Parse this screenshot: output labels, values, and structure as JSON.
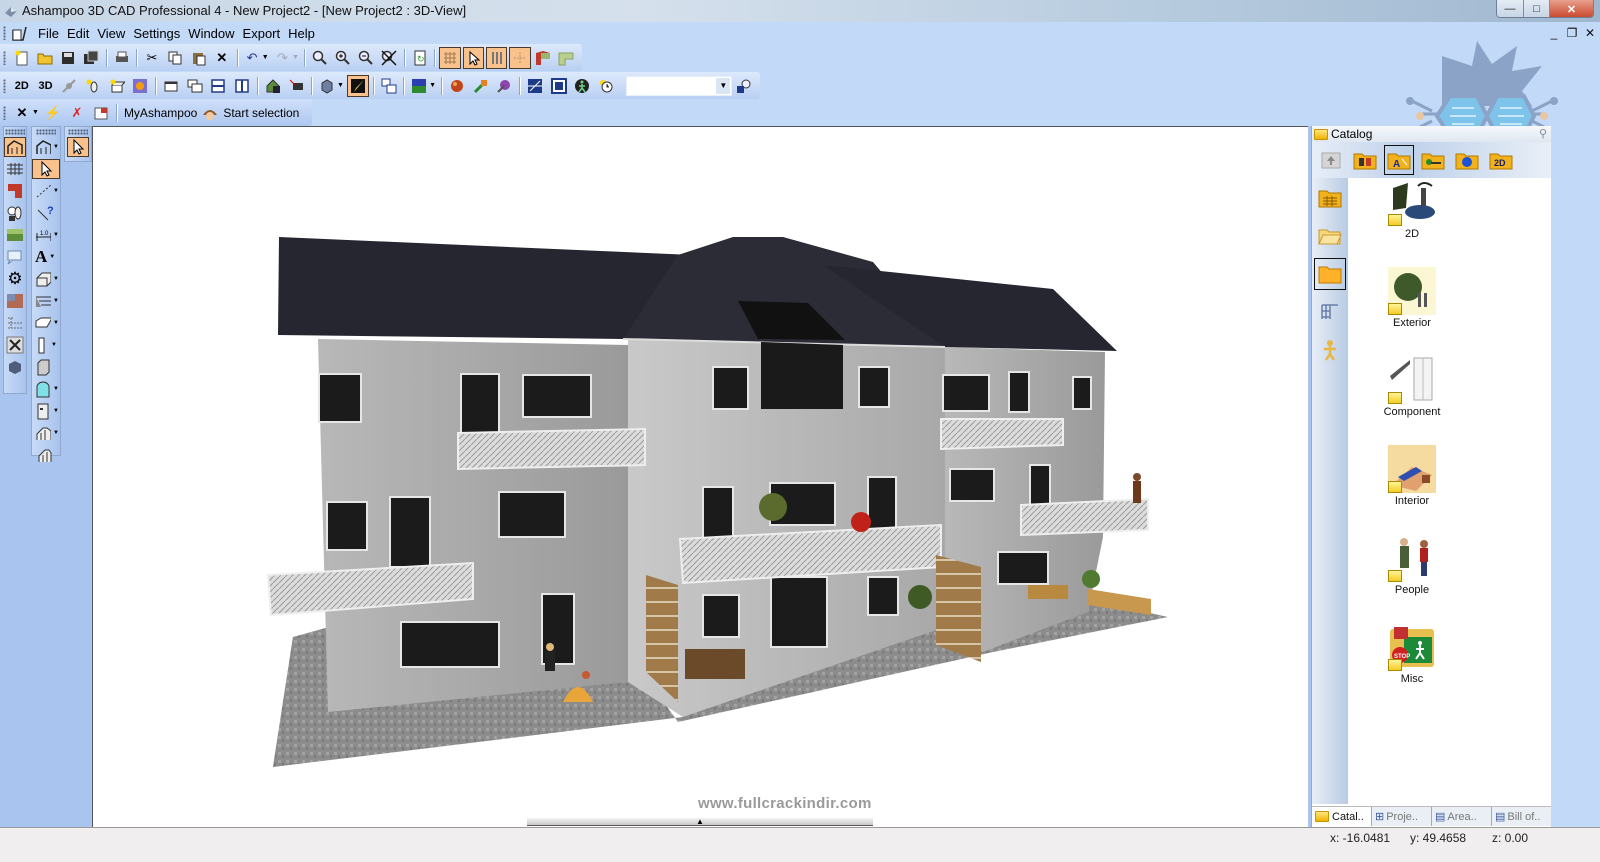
{
  "window": {
    "title": "Ashampoo 3D CAD Professional 4 - New Project2 - [New Project2 : 3D-View]",
    "controls": {
      "minimize": "—",
      "maximize": "□",
      "close": "✕"
    }
  },
  "menu": {
    "items": [
      {
        "label": "File",
        "accel": "F"
      },
      {
        "label": "Edit",
        "accel": "E"
      },
      {
        "label": "View",
        "accel": "V"
      },
      {
        "label": "Settings",
        "accel": "S"
      },
      {
        "label": "Window",
        "accel": "W"
      },
      {
        "label": "Export",
        "accel": "p"
      },
      {
        "label": "Help",
        "accel": "H"
      }
    ],
    "mdi_controls": {
      "minimize": "_",
      "restore": "❐",
      "close": "✕"
    }
  },
  "toolbar_main": {
    "buttons": [
      "new-file",
      "open-folder",
      "save",
      "save-all",
      "print",
      "cut",
      "copy",
      "paste",
      "delete",
      "undo",
      "redo",
      "zoom",
      "zoom-in",
      "zoom-out",
      "zoom-all",
      "refresh",
      "grid",
      "select-cursor",
      "columns",
      "snap-points",
      "roof-red",
      "roof-green"
    ],
    "active": [
      "grid",
      "select-cursor",
      "columns",
      "snap-points"
    ]
  },
  "toolbar_view": {
    "buttons": [
      "new-2d",
      "new-3d",
      "satellite",
      "light-bulb",
      "new-box",
      "texture-grid",
      "window-single",
      "window-cascade",
      "window-horizontal",
      "window-vertical",
      "house-save",
      "camera",
      "cube-view",
      "render-light",
      "copy-view",
      "background-color",
      "material-sphere",
      "material-transfer",
      "material-pick",
      "axis-cross",
      "frame-axis",
      "walk-figure",
      "sun-clock",
      "search-object"
    ],
    "combo_value": ""
  },
  "toolbar_extra": {
    "myashampoo_label": "MyAshampoo",
    "start_selection_label": "Start selection"
  },
  "left_toolbar_1": [
    "floor-plan",
    "wall-grid",
    "red-stair",
    "lamp-objects",
    "landscape",
    "bubble-view",
    "gear",
    "texture-tiles",
    "tree-list",
    "tools-hammer",
    "3d-cube"
  ],
  "left_toolbar_2": [
    "building-wizard",
    "select-arrow",
    "line-draw",
    "dimension-help",
    "measure",
    "text-tool",
    "wall",
    "ceiling",
    "slab",
    "column",
    "pillar",
    "window-arch",
    "door",
    "staircase",
    "roof-element"
  ],
  "left_toolbar_3": [
    "select-arrow"
  ],
  "viewport": {
    "label": "3D-View",
    "watermark": "www.fullcrackindir.com"
  },
  "catalog": {
    "title": "Catalog",
    "top_tabs": [
      "up",
      "building-parts",
      "symbols",
      "exterior-objects",
      "materials",
      "2d-symbols"
    ],
    "active_top_tab": "symbols",
    "side_buttons": [
      "catalog-grid",
      "open-folder",
      "folder",
      "tree-structure",
      "figure"
    ],
    "active_side_button": "folder",
    "items": [
      {
        "label": "2D"
      },
      {
        "label": "Exterior"
      },
      {
        "label": "Component"
      },
      {
        "label": "Interior"
      },
      {
        "label": "People"
      },
      {
        "label": "Misc"
      }
    ],
    "bottom_tabs": [
      {
        "label": "Catal..",
        "active": true
      },
      {
        "label": "Proje..",
        "active": false
      },
      {
        "label": "Area..",
        "active": false
      },
      {
        "label": "Bill of..",
        "active": false
      }
    ]
  },
  "status": {
    "x": "x: -16.0481",
    "y": "y: 49.4658",
    "z": "z: 0.00"
  },
  "colors": {
    "dock_bg": "#c2d9f7",
    "active_button": "#f9c28c",
    "roof": "#24252e",
    "wall": "#9c9c9c"
  }
}
